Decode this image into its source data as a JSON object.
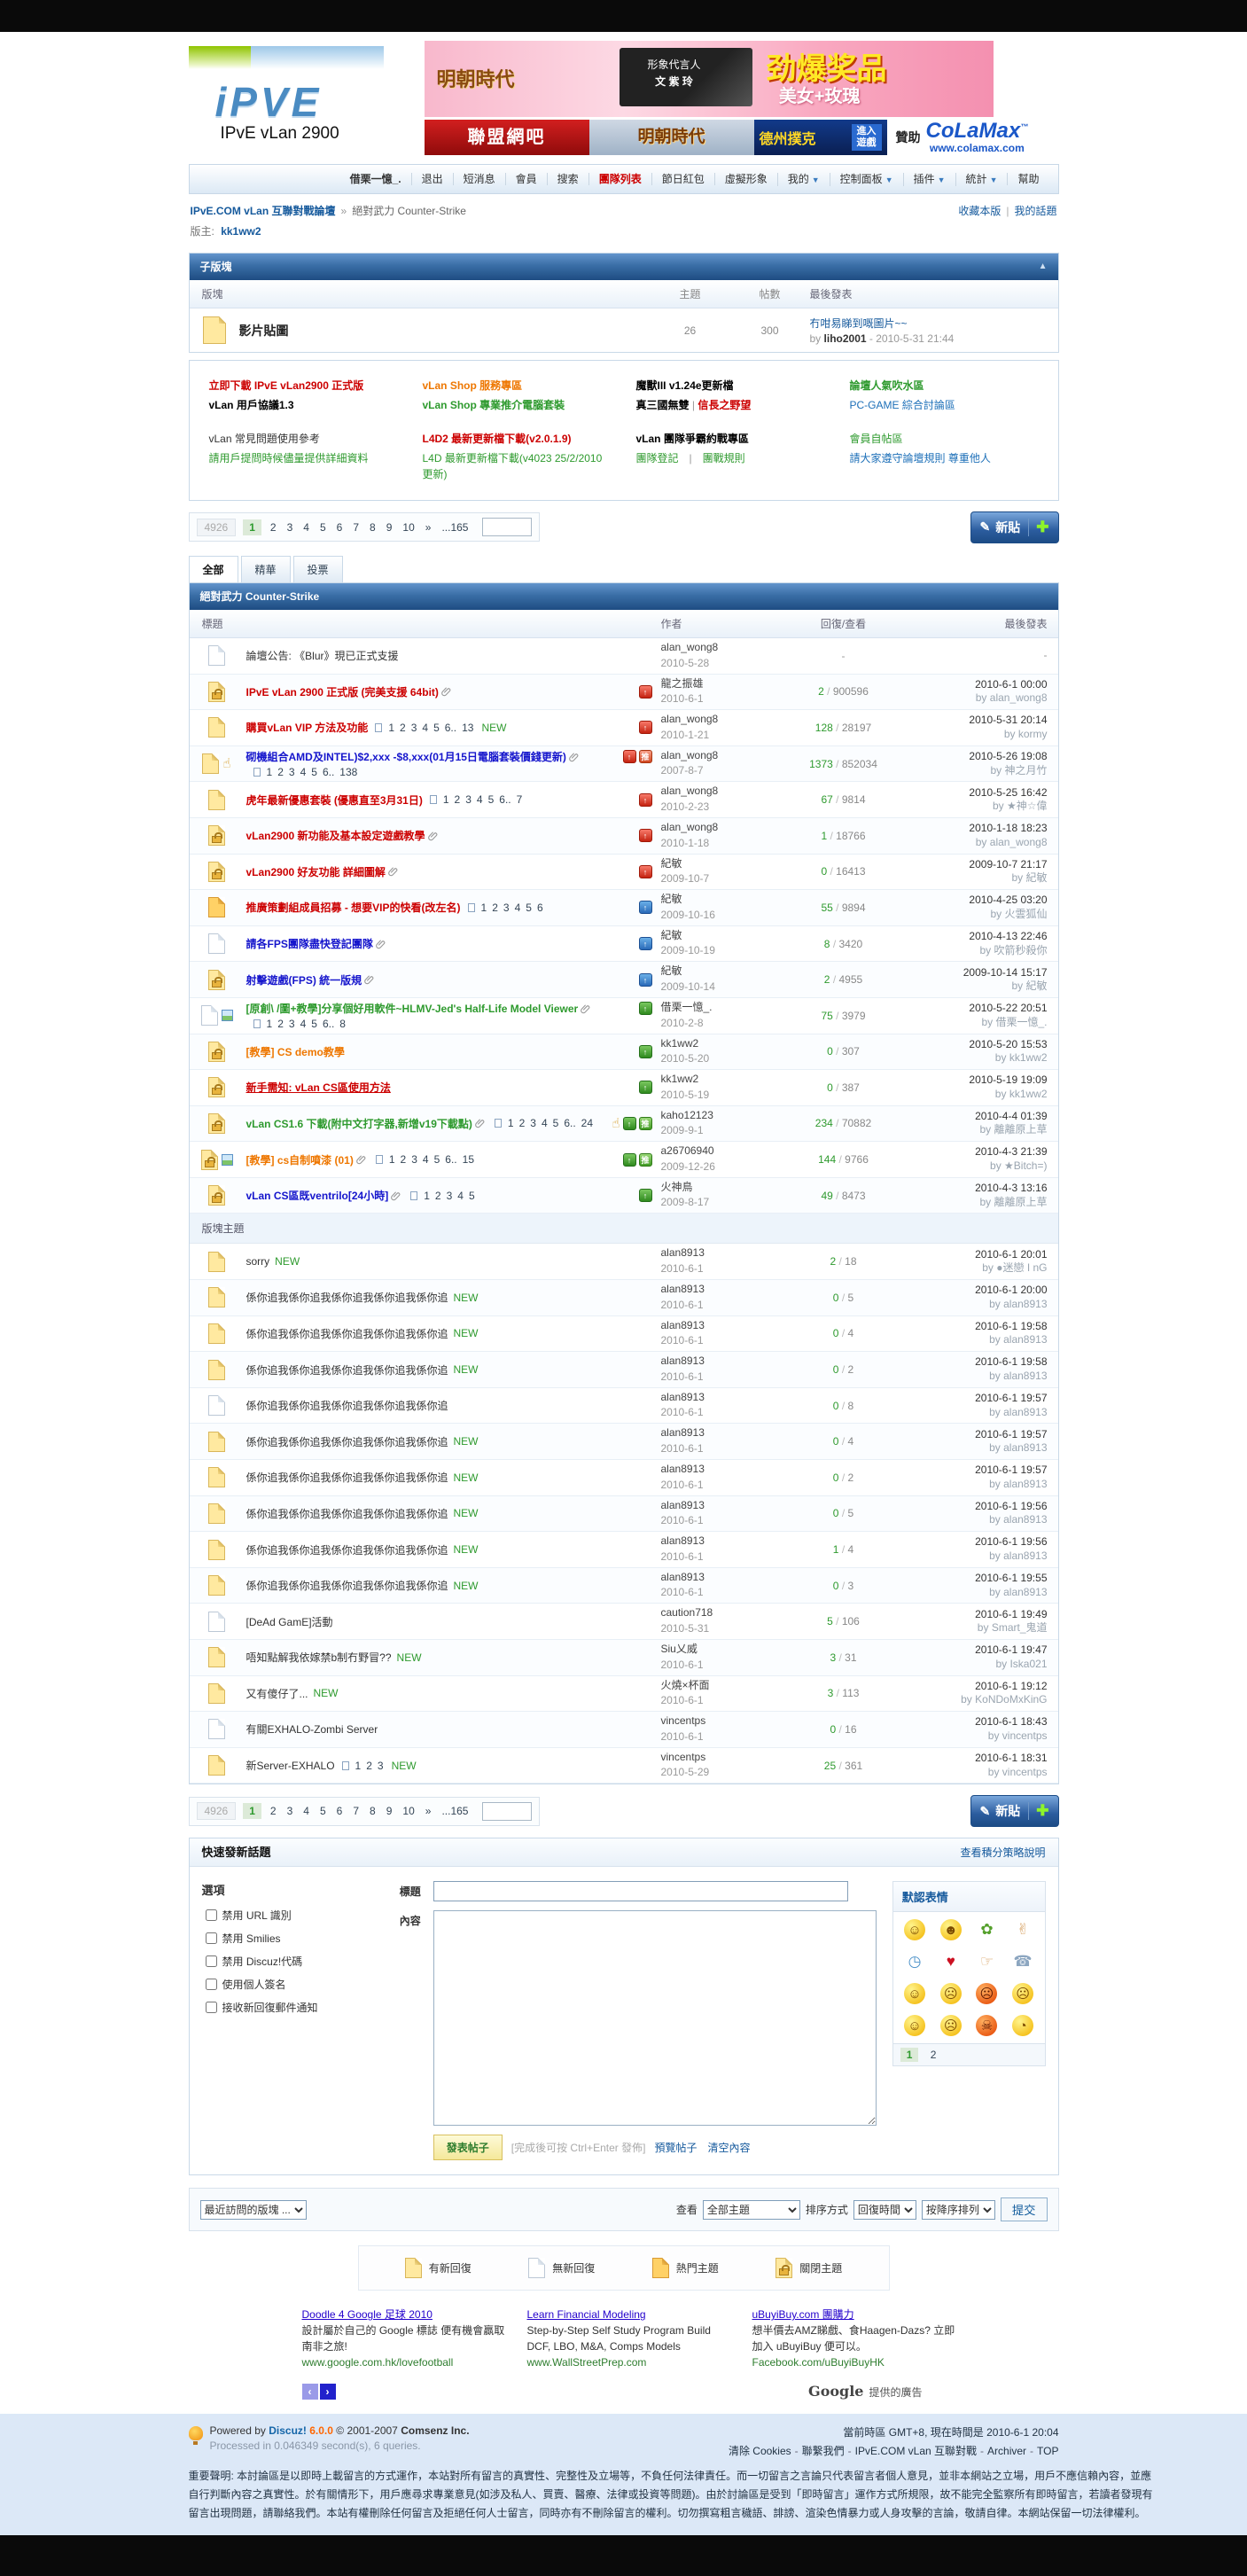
{
  "header": {
    "logo_text": "iPVE",
    "logo_sub": "IPvE vLan 2900",
    "banner": {
      "brand": "明朝時代",
      "big": "劲爆奖品",
      "sub": "美女+玫瑰",
      "spokes1": "形象代言人",
      "spokes2": "文 紫 玲",
      "red": "聯盟網吧",
      "ming": "明朝時代",
      "poker": "德州撲克",
      "enter": "進入遊戲",
      "sponsor_label": "贊助",
      "sponsor_name": "CoLaMax",
      "sponsor_tm": "™",
      "sponsor_url": "www.colamax.com"
    }
  },
  "nav": {
    "items": [
      {
        "label": "借栗一憶_.",
        "bold": true
      },
      {
        "label": "退出"
      },
      {
        "label": "短消息"
      },
      {
        "label": "會員"
      },
      {
        "label": "搜索"
      },
      {
        "label": "團隊列表",
        "red": true
      },
      {
        "label": "節日紅包"
      },
      {
        "label": "虛擬形象"
      },
      {
        "label": "我的",
        "dd": true
      },
      {
        "label": "控制面板",
        "dd": true
      },
      {
        "label": "插件",
        "dd": true
      },
      {
        "label": "統計",
        "dd": true
      },
      {
        "label": "幫助"
      }
    ]
  },
  "breadcrumb": {
    "root": "IPvE.COM vLan 互聯對戰論壇",
    "sep": "»",
    "current": "絕對武力 Counter-Strike",
    "fav": "收藏本版",
    "mytopic": "我的話題",
    "moderator_label": "版主:",
    "moderator": "kk1ww2"
  },
  "subforum": {
    "title": "子版塊",
    "collapse_icon": "▲",
    "cols": {
      "forum": "版塊",
      "topics": "主題",
      "posts": "帖數",
      "last": "最後發表"
    },
    "row": {
      "name": "影片貼圖",
      "topics": "26",
      "posts": "300",
      "last_title": "冇咁易睇到嘅圖片~~",
      "last_by_label": "by",
      "last_by": "liho2001",
      "last_date": "2010-5-31 21:44"
    }
  },
  "announce": {
    "columns": [
      [
        [
          {
            "t": "立即下載 IPvE vLan2900 正式版",
            "c": "#cc0000",
            "b": 1
          }
        ],
        [
          {
            "t": "vLan 用戶協議1.3",
            "c": "#000000",
            "b": 1
          }
        ],
        [
          {
            "t": ""
          }
        ],
        [
          {
            "t": "vLan 常見問題使用參考",
            "c": "#333333"
          }
        ],
        [
          {
            "t": "請用戶提問時候儘量提供詳細資料",
            "c": "#2e9a2e"
          }
        ]
      ],
      [
        [
          {
            "t": "vLan Shop 服務專區",
            "c": "#ee7700",
            "b": 1
          }
        ],
        [
          {
            "t": "vLan Shop 專業推介電腦套裝",
            "c": "#2e9a2e",
            "b": 1
          }
        ],
        [
          {
            "t": ""
          }
        ],
        [
          {
            "t": "L4D2 最新更新檔下載(v2.0.1.9)",
            "c": "#cc0000",
            "b": 1
          }
        ],
        [
          {
            "t": "L4D 最新更新檔下載(v4023 25/2/2010更新)",
            "c": "#2e9a2e"
          }
        ]
      ],
      [
        [
          {
            "t": "魔獸III v1.24e更新檔",
            "c": "#000000",
            "b": 1
          }
        ],
        [
          {
            "t": "真三國無雙",
            "c": "#000000",
            "b": 1
          },
          {
            "t": " | ",
            "c": "#999999"
          },
          {
            "t": "信長之野望",
            "c": "#cc0000",
            "b": 1
          }
        ],
        [
          {
            "t": ""
          }
        ],
        [
          {
            "t": "vLan 團隊爭霸約戰專區",
            "c": "#000000",
            "b": 1
          }
        ],
        [
          {
            "t": "團隊登記",
            "c": "#2e9a2e"
          },
          {
            "t": "　|　",
            "c": "#999999"
          },
          {
            "t": "團戰規則",
            "c": "#2e9a2e"
          }
        ]
      ],
      [
        [
          {
            "t": "論壇人氣吹水區",
            "c": "#2e9a2e",
            "b": 1
          }
        ],
        [
          {
            "t": "PC-GAME 綜合討論區",
            "c": "#1c6fb8"
          }
        ],
        [
          {
            "t": ""
          }
        ],
        [
          {
            "t": "會員自帖區",
            "c": "#2e9a2e"
          }
        ],
        [
          {
            "t": "請大家遵守論壇規則 尊重他人",
            "c": "#1c6fb8"
          }
        ]
      ]
    ]
  },
  "pagination": {
    "total": "4926",
    "current": "1",
    "pages": [
      "2",
      "3",
      "4",
      "5",
      "6",
      "7",
      "8",
      "9",
      "10"
    ],
    "next": "»",
    "last": "...165",
    "new_btn": "新貼",
    "pen_icon": "✎",
    "plus_icon": "✚"
  },
  "tabs": [
    {
      "label": "全部",
      "active": true
    },
    {
      "label": "精華"
    },
    {
      "label": "投票"
    }
  ],
  "forum": {
    "title": "絕對武力 Counter-Strike",
    "cols": {
      "title": "標題",
      "author": "作者",
      "nums": "回復/查看",
      "last": "最後發表"
    },
    "section_label": "版塊主題",
    "by_label": "by"
  },
  "sticky_threads": [
    {
      "ic": "old",
      "t": "論壇公告: 《Blur》現已正式支援",
      "s": "plain",
      "au": "alan_wong8",
      "ad": "2010-5-28",
      "dash": 1
    },
    {
      "ic": "lock",
      "t": "IPvE vLan 2900 正式版 (完美支援 64bit)",
      "s": "red",
      "at": 1,
      "pins": [
        "pin-red"
      ],
      "au": "龍之振雄",
      "ad": "2010-6-1",
      "rp": "2",
      "vw": "900596",
      "ld": "2010-6-1 00:00",
      "lb": "alan_wong8"
    },
    {
      "ic": "new",
      "t": "購買vLan VIP 方法及功能",
      "s": "red",
      "pg": [
        "1",
        "2",
        "3",
        "4",
        "5",
        "6..",
        "13"
      ],
      "nw": 1,
      "pins": [
        "pin-red"
      ],
      "au": "alan_wong8",
      "ad": "2010-1-21",
      "rp": "128",
      "vw": "28197",
      "ld": "2010-5-31 20:14",
      "lb": "kormy"
    },
    {
      "ic": "new",
      "li": "thumb",
      "t": "砌機組合AMD及INTEL)$2,xxx -$8,xxx(01月15日電腦套裝價錢更新)",
      "s": "blue",
      "at": 1,
      "pins": [
        "pin-red",
        "rec-red"
      ],
      "pg2": [
        "1",
        "2",
        "3",
        "4",
        "5",
        "6..",
        "138"
      ],
      "au": "alan_wong8",
      "ad": "2007-8-7",
      "rp": "1373",
      "vw": "852034",
      "ld": "2010-5-26 19:08",
      "lb": "神之月竹"
    },
    {
      "ic": "new",
      "t": "虎年最新優惠套裝 (優惠直至3月31日)",
      "s": "red",
      "pg": [
        "1",
        "2",
        "3",
        "4",
        "5",
        "6..",
        "7"
      ],
      "pins": [
        "pin-red"
      ],
      "au": "alan_wong8",
      "ad": "2010-2-23",
      "rp": "67",
      "vw": "9814",
      "ld": "2010-5-25 16:42",
      "lb": "★神☆偉"
    },
    {
      "ic": "lock",
      "t": "vLan2900 新功能及基本設定遊戲教學",
      "s": "red",
      "at": 1,
      "pins": [
        "pin-red"
      ],
      "au": "alan_wong8",
      "ad": "2010-1-18",
      "rp": "1",
      "vw": "18766",
      "ld": "2010-1-18 18:23",
      "lb": "alan_wong8"
    },
    {
      "ic": "lock",
      "t": "vLan2900 好友功能 詳細圖解",
      "s": "red",
      "at": 1,
      "pins": [
        "pin-red"
      ],
      "au": "紀敏",
      "ad": "2009-10-7",
      "rp": "0",
      "vw": "16413",
      "ld": "2009-10-7 21:17",
      "lb": "紀敏"
    },
    {
      "ic": "hot",
      "t": "推廣策劃組成員招募 - 想要VIP的快看(改左名)",
      "s": "red",
      "pg": [
        "1",
        "2",
        "3",
        "4",
        "5",
        "6"
      ],
      "pins": [
        "pin-blue"
      ],
      "au": "紀敏",
      "ad": "2009-10-16",
      "rp": "55",
      "vw": "9894",
      "ld": "2010-4-25 03:20",
      "lb": "火雲狐仙"
    },
    {
      "ic": "old",
      "t": "請各FPS團隊盡快登記團隊",
      "s": "blue",
      "at": 1,
      "pins": [
        "pin-blue"
      ],
      "au": "紀敏",
      "ad": "2009-10-19",
      "rp": "8",
      "vw": "3420",
      "ld": "2010-4-13 22:46",
      "lb": "吹箭秒殺你"
    },
    {
      "ic": "lock",
      "t": "射擊遊戲(FPS) 統一版規",
      "s": "blue",
      "at": 1,
      "pins": [
        "pin-blue"
      ],
      "au": "紀敏",
      "ad": "2009-10-14",
      "rp": "2",
      "vw": "4955",
      "ld": "2009-10-14 15:17",
      "lb": "紀敏"
    },
    {
      "ic": "old",
      "li": "img",
      "t": "[原創\\ /圖+教學]分享個好用軟件~HLMV-Jed's Half-Life Model Viewer",
      "s": "green",
      "at": 1,
      "pins": [
        "pin-green"
      ],
      "pg2": [
        "1",
        "2",
        "3",
        "4",
        "5",
        "6..",
        "8"
      ],
      "au": "借栗一憶_.",
      "ad": "2010-2-8",
      "rp": "75",
      "vw": "3979",
      "ld": "2010-5-22 20:51",
      "lb": "借栗一憶_."
    },
    {
      "ic": "lock",
      "t": "[教學] CS demo教學",
      "s": "orange",
      "pins": [
        "pin-green"
      ],
      "au": "kk1ww2",
      "ad": "2010-5-20",
      "rp": "0",
      "vw": "307",
      "ld": "2010-5-20 15:53",
      "lb": "kk1ww2"
    },
    {
      "ic": "lock",
      "t": "新手需知: vLan CS區使用方法",
      "s": "redline",
      "pins": [
        "pin-green"
      ],
      "au": "kk1ww2",
      "ad": "2010-5-19",
      "rp": "0",
      "vw": "387",
      "ld": "2010-5-19 19:09",
      "lb": "kk1ww2"
    },
    {
      "ic": "lock",
      "t": "vLan CS1.6 下載(附中文打字器,新增v19下載點)",
      "s": "green",
      "at": 1,
      "pg": [
        "1",
        "2",
        "3",
        "4",
        "5",
        "6..",
        "24"
      ],
      "pins": [
        "thumb",
        "pin-green",
        "rec-green"
      ],
      "au": "kaho12123",
      "ad": "2009-9-1",
      "rp": "234",
      "vw": "70882",
      "ld": "2010-4-4 01:39",
      "lb": "離離原上草"
    },
    {
      "ic": "lock",
      "li": "img",
      "t": "[教學] cs自制噴漆 (01)",
      "s": "orange",
      "at": 1,
      "pg": [
        "1",
        "2",
        "3",
        "4",
        "5",
        "6..",
        "15"
      ],
      "pins": [
        "pin-green",
        "rec-green"
      ],
      "au": "a26706940",
      "ad": "2009-12-26",
      "rp": "144",
      "vw": "9766",
      "ld": "2010-4-3 21:39",
      "lb": "★Bitch=)"
    },
    {
      "ic": "lock",
      "t": "vLan CS區既ventrilo[24小時]",
      "s": "blue",
      "at": 1,
      "pg": [
        "1",
        "2",
        "3",
        "4",
        "5"
      ],
      "pins": [
        "pin-green"
      ],
      "au": "火神鳥",
      "ad": "2009-8-17",
      "rp": "49",
      "vw": "8473",
      "ld": "2010-4-3 13:16",
      "lb": "離離原上草"
    }
  ],
  "normal_threads": [
    {
      "ic": "new",
      "t": "sorry",
      "nw": 1,
      "au": "alan8913",
      "ad": "2010-6-1",
      "rp": "2",
      "vw": "18",
      "ld": "2010-6-1 20:01",
      "lb": "●迷戀 I nG"
    },
    {
      "ic": "new",
      "t": "係你追我係你追我係你追我係你追我係你追",
      "nw": 1,
      "au": "alan8913",
      "ad": "2010-6-1",
      "rp": "0",
      "vw": "5",
      "ld": "2010-6-1 20:00",
      "lb": "alan8913"
    },
    {
      "ic": "new",
      "t": "係你追我係你追我係你追我係你追我係你追",
      "nw": 1,
      "au": "alan8913",
      "ad": "2010-6-1",
      "rp": "0",
      "vw": "4",
      "ld": "2010-6-1 19:58",
      "lb": "alan8913"
    },
    {
      "ic": "new",
      "t": "係你追我係你追我係你追我係你追我係你追",
      "nw": 1,
      "au": "alan8913",
      "ad": "2010-6-1",
      "rp": "0",
      "vw": "2",
      "ld": "2010-6-1 19:58",
      "lb": "alan8913"
    },
    {
      "ic": "old",
      "t": "係你追我係你追我係你追我係你追我係你追",
      "au": "alan8913",
      "ad": "2010-6-1",
      "rp": "0",
      "vw": "8",
      "ld": "2010-6-1 19:57",
      "lb": "alan8913"
    },
    {
      "ic": "new",
      "t": "係你追我係你追我係你追我係你追我係你追",
      "nw": 1,
      "au": "alan8913",
      "ad": "2010-6-1",
      "rp": "0",
      "vw": "4",
      "ld": "2010-6-1 19:57",
      "lb": "alan8913"
    },
    {
      "ic": "new",
      "t": "係你追我係你追我係你追我係你追我係你追",
      "nw": 1,
      "au": "alan8913",
      "ad": "2010-6-1",
      "rp": "0",
      "vw": "2",
      "ld": "2010-6-1 19:57",
      "lb": "alan8913"
    },
    {
      "ic": "new",
      "t": "係你追我係你追我係你追我係你追我係你追",
      "nw": 1,
      "au": "alan8913",
      "ad": "2010-6-1",
      "rp": "0",
      "vw": "5",
      "ld": "2010-6-1 19:56",
      "lb": "alan8913"
    },
    {
      "ic": "new",
      "t": "係你追我係你追我係你追我係你追我係你追",
      "nw": 1,
      "au": "alan8913",
      "ad": "2010-6-1",
      "rp": "1",
      "vw": "4",
      "ld": "2010-6-1 19:56",
      "lb": "alan8913"
    },
    {
      "ic": "new",
      "t": "係你追我係你追我係你追我係你追我係你追",
      "nw": 1,
      "au": "alan8913",
      "ad": "2010-6-1",
      "rp": "0",
      "vw": "3",
      "ld": "2010-6-1 19:55",
      "lb": "alan8913"
    },
    {
      "ic": "old",
      "t": "[DeAd GamE]活動",
      "au": "caution718",
      "ad": "2010-5-31",
      "rp": "5",
      "vw": "106",
      "ld": "2010-6-1 19:49",
      "lb": "Smart_鬼道"
    },
    {
      "ic": "new",
      "t": "唔知點解我依嫁禁b制冇野冒??",
      "nw": 1,
      "au": "Siu乂威",
      "ad": "2010-6-1",
      "rp": "3",
      "vw": "31",
      "ld": "2010-6-1 19:47",
      "lb": "Iska021"
    },
    {
      "ic": "new",
      "t": "又有傻仔了...",
      "nw": 1,
      "au": "火燒×杯面",
      "ad": "2010-6-1",
      "rp": "3",
      "vw": "113",
      "ld": "2010-6-1 19:12",
      "lb": "KoNDoMxKinG"
    },
    {
      "ic": "old",
      "t": "有關EXHALO-Zombi Server",
      "au": "vincentps",
      "ad": "2010-6-1",
      "rp": "0",
      "vw": "16",
      "ld": "2010-6-1 18:43",
      "lb": "vincentps"
    },
    {
      "ic": "new",
      "t": "新Server-EXHALO",
      "pg": [
        "1",
        "2",
        "3"
      ],
      "nw": 1,
      "au": "vincentps",
      "ad": "2010-5-29",
      "rp": "25",
      "vw": "361",
      "ld": "2010-6-1 18:31",
      "lb": "vincentps"
    }
  ],
  "quickpost": {
    "title": "快速發新話題",
    "credits_link": "查看積分策略說明",
    "options_label": "選項",
    "checkboxes": [
      "禁用 URL 識別",
      "禁用 Smilies",
      "禁用 Discuz!代碼",
      "使用個人簽名",
      "接收新回復郵件通知"
    ],
    "subject_label": "標題",
    "content_label": "內容",
    "submit": "發表帖子",
    "hint": "[完成後可按 Ctrl+Enter 發佈]",
    "preview": "預覽帖子",
    "clear": "清空內容"
  },
  "smilies": {
    "title": "默認表情",
    "page_current": "1",
    "page_other": "2",
    "faces": [
      {
        "name": "smile-smiley",
        "g": "☺",
        "face": 1
      },
      {
        "name": "grin-smiley",
        "g": "☻",
        "face": 1
      },
      {
        "name": "hug-smiley",
        "g": "✿",
        "c": "#55a02c"
      },
      {
        "name": "victory-smiley",
        "g": "✌",
        "c": "#d9a66a"
      },
      {
        "name": "clock-smiley",
        "g": "◷",
        "c": "#4a90c8"
      },
      {
        "name": "kiss-smiley",
        "g": "♥",
        "c": "#cc1122"
      },
      {
        "name": "handshake-smiley",
        "g": "☞",
        "c": "#d9a66a"
      },
      {
        "name": "phone-smiley",
        "g": "☎",
        "c": "#8ca6c0"
      },
      {
        "name": "blush-smiley",
        "g": "☺",
        "face": 1
      },
      {
        "name": "cry-smiley",
        "g": "☹",
        "face": 1
      },
      {
        "name": "angry-smiley",
        "g": "☹",
        "face": 1,
        "hot": 1
      },
      {
        "name": "sad-smiley",
        "g": "☹",
        "face": 1
      },
      {
        "name": "laugh-smiley",
        "g": "☺",
        "face": 1
      },
      {
        "name": "sob-smiley",
        "g": "☹",
        "face": 1
      },
      {
        "name": "devil-smiley",
        "g": "☠",
        "face": 1,
        "hot": 1
      },
      {
        "name": "curious-smiley",
        "g": "◔",
        "face": 1
      }
    ]
  },
  "controls": {
    "recent_label": "最近訪問的版塊 ...",
    "view_label": "查看",
    "view_value": "全部主題",
    "sort_label": "排序方式",
    "sort_value": "回復時間",
    "order_value": "按降序排列",
    "submit": "提交"
  },
  "legend": [
    {
      "icon": "new",
      "label": "有新回復"
    },
    {
      "icon": "old",
      "label": "無新回復"
    },
    {
      "icon": "hot",
      "label": "熱門主題"
    },
    {
      "icon": "lock",
      "label": "關閉主題"
    }
  ],
  "ads": {
    "items": [
      {
        "title": "Doodle 4 Google 足球 2010",
        "body": "設計屬於自己的 Google 標誌 便有機會贏取南非之旅!",
        "url": "www.google.com.hk/lovefootball"
      },
      {
        "title": "Learn Financial Modeling",
        "body": "Step-by-Step Self Study Program Build DCF, LBO, M&A, Comps Models",
        "url": "www.WallStreetPrep.com"
      },
      {
        "title": "uBuyiBuy.com 團購力",
        "body": "想半價去AMZ睇戲、食Haagen-Dazs? 立即加入 uBuyiBuy 便可以。",
        "url": "Facebook.com/uBuyiBuyHK"
      }
    ],
    "prev": "‹",
    "next": "›",
    "google": "Google",
    "note": "提供的廣告"
  },
  "footer": {
    "powered_prefix": "Powered by",
    "discuz": "Discuz!",
    "version": "6.0.0",
    "copyright": "© 2001-2007",
    "company": "Comsenz Inc.",
    "processed": "Processed in 0.046349 second(s), 6 queries.",
    "timezone": "當前時區 GMT+8, 現在時間是 2010-6-1 20:04",
    "links": [
      "清除 Cookies",
      "聯繫我們",
      "IPvE.COM vLan 互聯對戰",
      "Archiver",
      "TOP"
    ],
    "disclaimer": "重要聲明: 本討論區是以即時上載留言的方式運作，本站對所有留言的真實性、完整性及立場等，不負任何法律責任。而一切留言之言論只代表留言者個人意見，並非本網站之立場，用戶不應信賴內容，並應自行判斷內容之真實性。於有關情形下，用戶應尋求專業意見(如涉及私人、買賣、醫療、法律或投資等問題)。由於討論區是受到「即時留言」運作方式所規限，故不能完全監察所有即時留言，若讀者發現有留言出現問題，請聯絡我們。本站有權刪除任何留言及拒絕任何人士留言，同時亦有不刪除留言的權利。切勿撰寫粗言穢語、誹謗、渲染色情暴力或人身攻擊的言論，敬請自律。本網站保留一切法律權利。"
  }
}
